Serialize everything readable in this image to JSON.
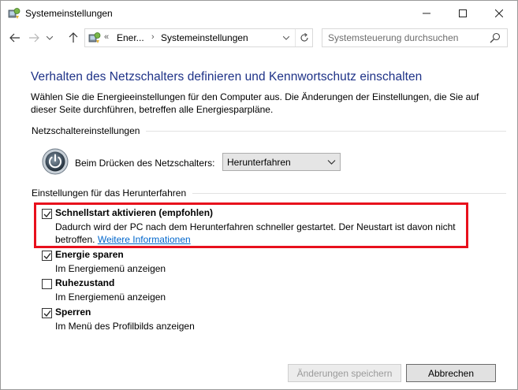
{
  "window": {
    "title": "Systemeinstellungen",
    "minimize_glyph": "—",
    "maximize_glyph": "☐",
    "close_glyph": "✕"
  },
  "nav": {
    "back_icon": "arrow-left-icon",
    "forward_icon": "arrow-right-icon",
    "up_icon": "arrow-up-icon",
    "breadcrumb_prefix": "«",
    "breadcrumb": [
      "Ener...",
      "Systemeinstellungen"
    ],
    "breadcrumb_sep": "›",
    "search_placeholder": "Systemsteuerung durchsuchen"
  },
  "main": {
    "title": "Verhalten des Netzschalters definieren und Kennwortschutz einschalten",
    "description": "Wählen Sie die Energieeinstellungen für den Computer aus. Die Änderungen der Einstellungen, die Sie auf dieser Seite durchführen, betreffen alle Energiesparpläne.",
    "power_section_label": "Netzschaltereinstellungen",
    "power_button_label": "Beim Drücken des Netzschalters:",
    "power_button_value": "Herunterfahren",
    "shutdown_section_label": "Einstellungen für das Herunterfahren"
  },
  "options": [
    {
      "title": "Schnellstart aktivieren (empfohlen)",
      "desc": "Dadurch wird der PC nach dem Herunterfahren schneller gestartet. Der Neustart ist davon nicht",
      "desc2": "betroffen.",
      "link": "Weitere Informationen",
      "checked": true
    },
    {
      "title": "Energie sparen",
      "desc": "Im Energiemenü anzeigen",
      "checked": true
    },
    {
      "title": "Ruhezustand",
      "desc": "Im Energiemenü anzeigen",
      "checked": false
    },
    {
      "title": "Sperren",
      "desc": "Im Menü des Profilbilds anzeigen",
      "checked": true
    }
  ],
  "footer": {
    "save_label": "Änderungen speichern",
    "cancel_label": "Abbrechen"
  },
  "colors": {
    "title_blue": "#1e3287",
    "highlight_red": "#e8101c",
    "link_blue": "#0066cc"
  }
}
